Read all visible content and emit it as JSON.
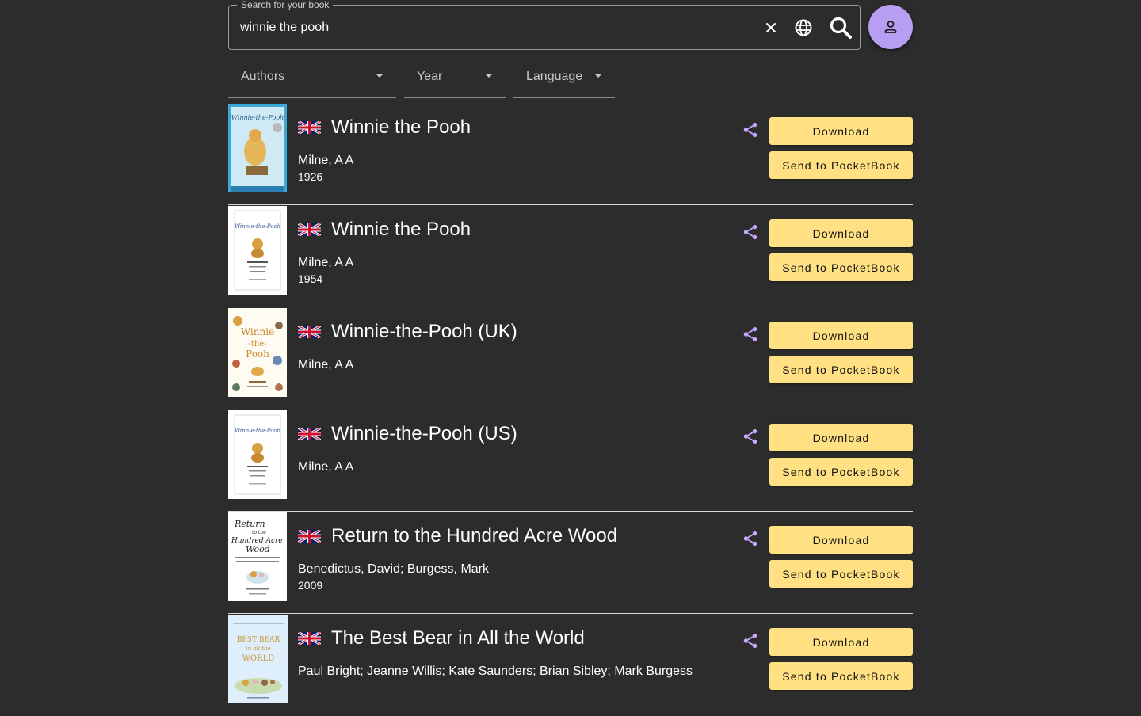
{
  "search": {
    "legend": "Search for your book",
    "value": "winnie the pooh",
    "placeholder": "Search for your book"
  },
  "filters": {
    "authors": "Authors",
    "year": "Year",
    "language": "Language"
  },
  "buttons": {
    "download": "Download",
    "send": "Send to PocketBook"
  },
  "colors": {
    "background": "#2c2c2c",
    "accent": "#b89ef0",
    "button": "#ffe082",
    "share": "#c9a7ff"
  },
  "books": [
    {
      "title": "Winnie the Pooh",
      "authors": "Milne, A A",
      "year": "1926",
      "language_flag": "uk-flag-icon"
    },
    {
      "title": "Winnie the Pooh",
      "authors": "Milne, A A",
      "year": "1954",
      "language_flag": "uk-flag-icon"
    },
    {
      "title": "Winnie-the-Pooh (UK)",
      "authors": "Milne, A A",
      "year": "",
      "language_flag": "uk-flag-icon"
    },
    {
      "title": "Winnie-the-Pooh (US)",
      "authors": "Milne, A A",
      "year": "",
      "language_flag": "uk-flag-icon"
    },
    {
      "title": "Return to the Hundred Acre Wood",
      "authors": "Benedictus, David; Burgess, Mark",
      "year": "2009",
      "language_flag": "uk-flag-icon"
    },
    {
      "title": "The Best Bear in All the World",
      "authors": "Paul Bright; Jeanne Willis; Kate Saunders; Brian Sibley; Mark Burgess",
      "year": "",
      "language_flag": "uk-flag-icon"
    }
  ]
}
